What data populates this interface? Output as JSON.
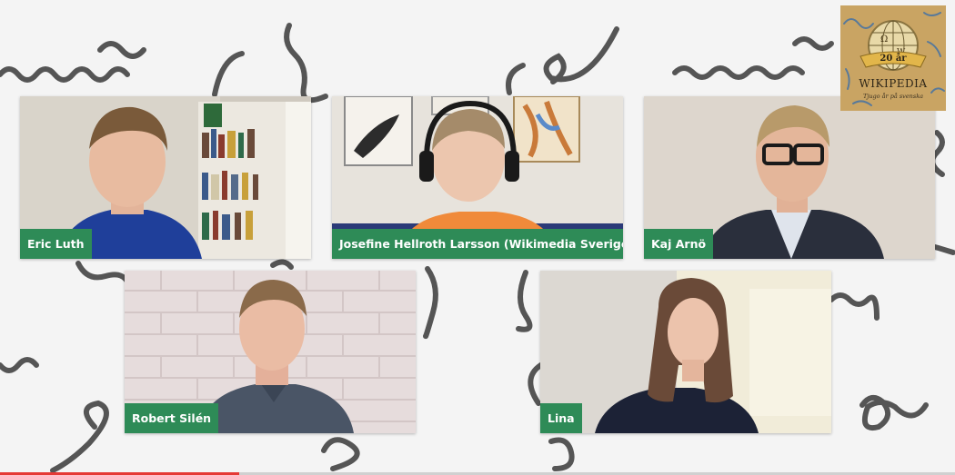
{
  "badge": {
    "anniversary": "20 år",
    "title": "Wikipedia",
    "tagline": "Tjugo år på svenska"
  },
  "participants": [
    {
      "name": "Eric Luth"
    },
    {
      "name": "Josefine Hellroth Larsson (Wikimedia Sverige)"
    },
    {
      "name": "Kaj Arnö"
    },
    {
      "name": "Robert Silén"
    },
    {
      "name": "Lina"
    }
  ],
  "colors": {
    "name_tag": "#2e8b57",
    "squiggle": "#555555",
    "progress": "#e53935",
    "background": "#f4f4f4"
  },
  "playback": {
    "progress": 0.25
  }
}
